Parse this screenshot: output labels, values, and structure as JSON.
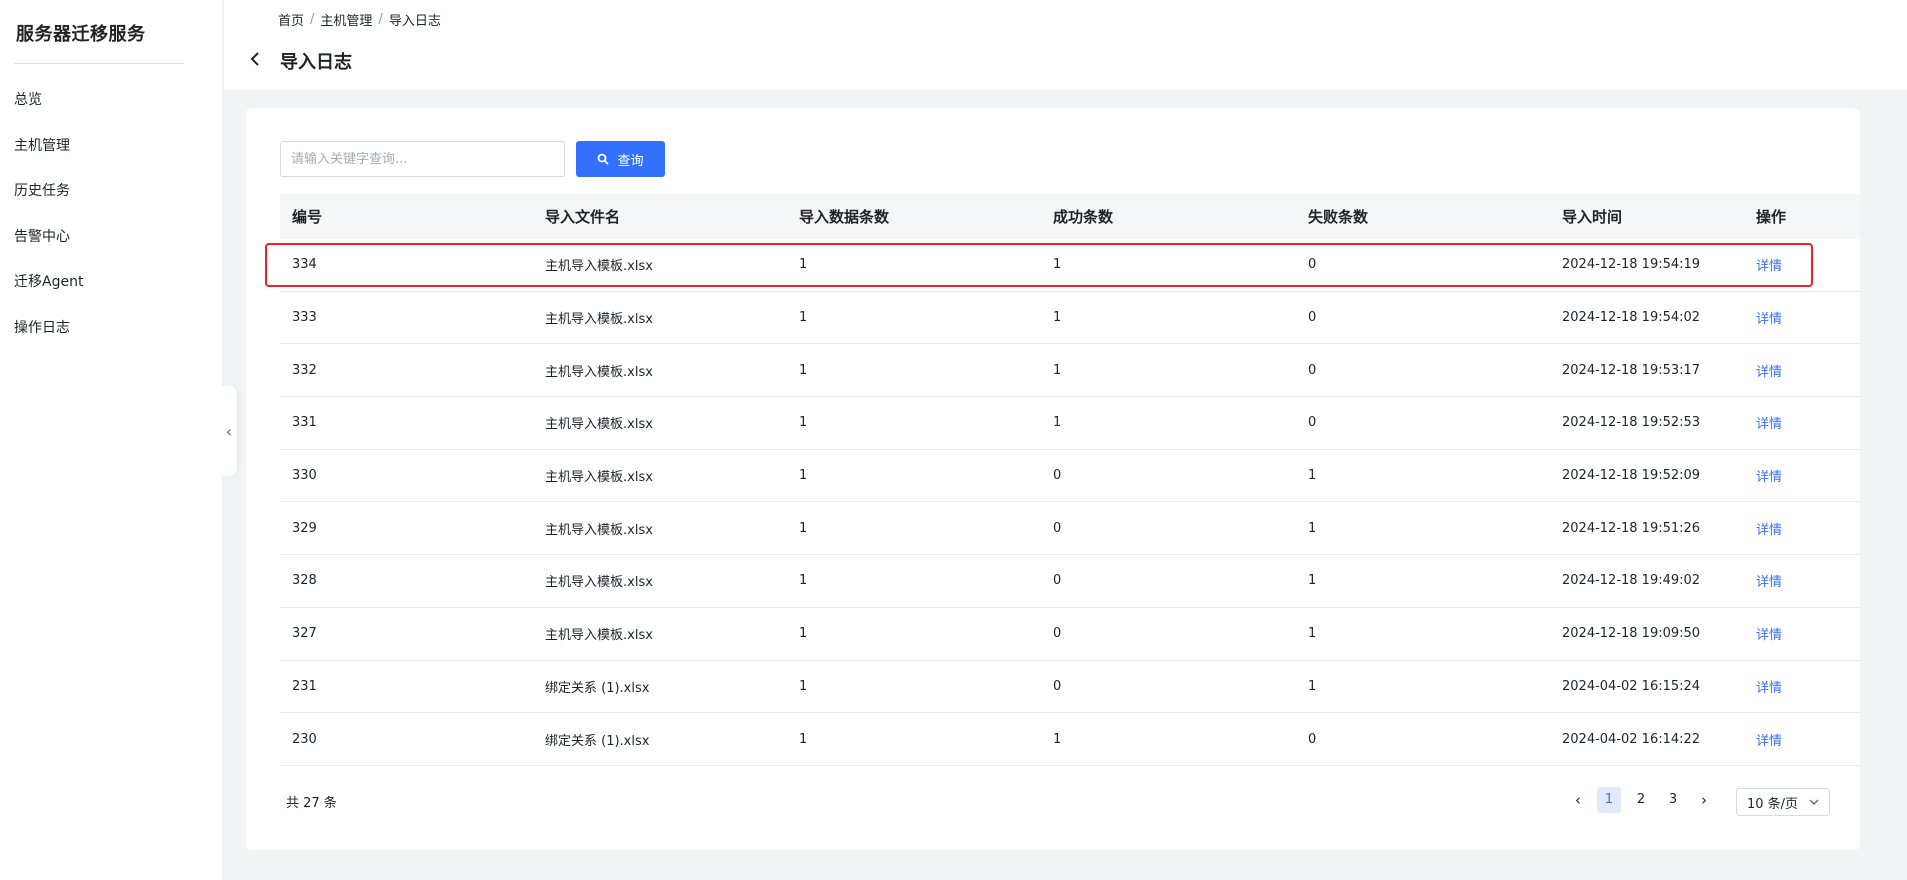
{
  "sidebar": {
    "title": "服务器迁移服务",
    "items": [
      {
        "label": "总览"
      },
      {
        "label": "主机管理"
      },
      {
        "label": "历史任务"
      },
      {
        "label": "告警中心"
      },
      {
        "label": "迁移Agent"
      },
      {
        "label": "操作日志"
      }
    ]
  },
  "breadcrumb": [
    "首页",
    "主机管理",
    "导入日志"
  ],
  "page_title": "导入日志",
  "search": {
    "placeholder": "请输入关键字查询...",
    "button_label": "查询"
  },
  "table": {
    "headers": [
      "编号",
      "导入文件名",
      "导入数据条数",
      "成功条数",
      "失败条数",
      "导入时间",
      "操作"
    ],
    "rows": [
      {
        "id": "334",
        "file": "主机导入模板.xlsx",
        "total": "1",
        "success": "1",
        "fail": "0",
        "time": "2024-12-18 19:54:19",
        "action": "详情"
      },
      {
        "id": "333",
        "file": "主机导入模板.xlsx",
        "total": "1",
        "success": "1",
        "fail": "0",
        "time": "2024-12-18 19:54:02",
        "action": "详情"
      },
      {
        "id": "332",
        "file": "主机导入模板.xlsx",
        "total": "1",
        "success": "1",
        "fail": "0",
        "time": "2024-12-18 19:53:17",
        "action": "详情"
      },
      {
        "id": "331",
        "file": "主机导入模板.xlsx",
        "total": "1",
        "success": "1",
        "fail": "0",
        "time": "2024-12-18 19:52:53",
        "action": "详情"
      },
      {
        "id": "330",
        "file": "主机导入模板.xlsx",
        "total": "1",
        "success": "0",
        "fail": "1",
        "time": "2024-12-18 19:52:09",
        "action": "详情"
      },
      {
        "id": "329",
        "file": "主机导入模板.xlsx",
        "total": "1",
        "success": "0",
        "fail": "1",
        "time": "2024-12-18 19:51:26",
        "action": "详情"
      },
      {
        "id": "328",
        "file": "主机导入模板.xlsx",
        "total": "1",
        "success": "0",
        "fail": "1",
        "time": "2024-12-18 19:49:02",
        "action": "详情"
      },
      {
        "id": "327",
        "file": "主机导入模板.xlsx",
        "total": "1",
        "success": "0",
        "fail": "1",
        "time": "2024-12-18 19:09:50",
        "action": "详情"
      },
      {
        "id": "231",
        "file": "绑定关系 (1).xlsx",
        "total": "1",
        "success": "0",
        "fail": "1",
        "time": "2024-04-02 16:15:24",
        "action": "详情"
      },
      {
        "id": "230",
        "file": "绑定关系 (1).xlsx",
        "total": "1",
        "success": "1",
        "fail": "0",
        "time": "2024-04-02 16:14:22",
        "action": "详情"
      }
    ]
  },
  "footer": {
    "total_text": "共 27 条",
    "pages": [
      "1",
      "2",
      "3"
    ],
    "active_page": "1",
    "page_size": "10 条/页"
  },
  "colors": {
    "accent": "#3370ff",
    "highlight": "#e8222e"
  },
  "icons": [
    "back-arrow-icon",
    "search-icon",
    "collapse-arrow-icon",
    "chevron-left-icon",
    "chevron-right-icon",
    "chevron-down-icon"
  ]
}
